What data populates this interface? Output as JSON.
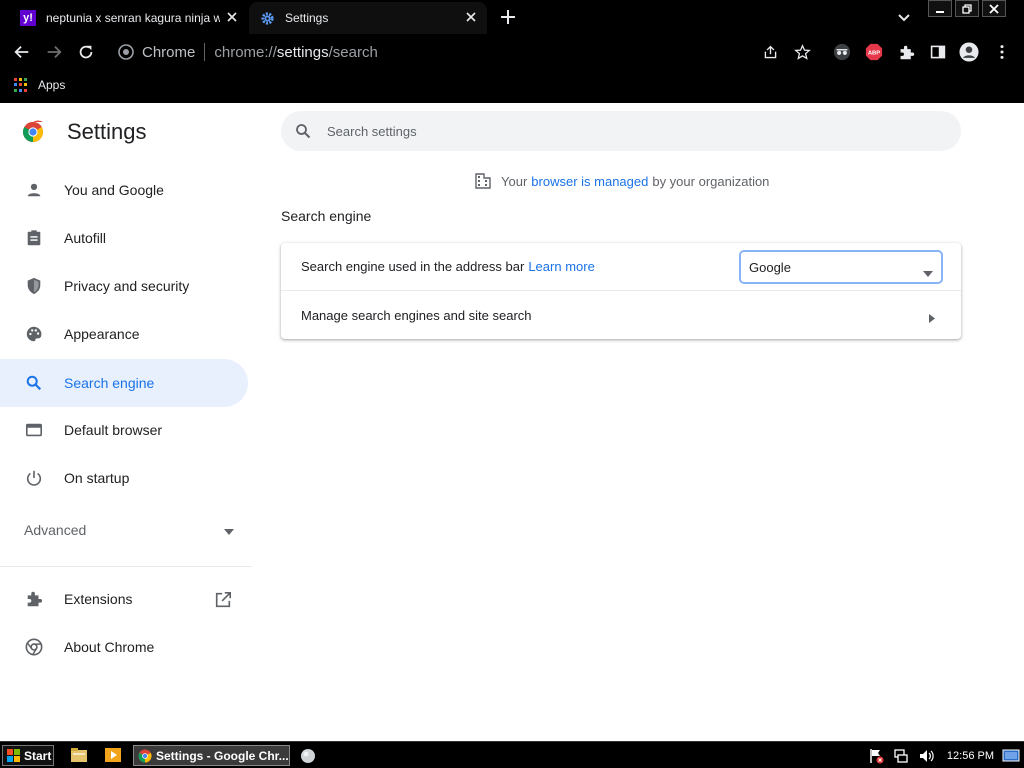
{
  "browser": {
    "tabs": [
      {
        "title": "neptunia x senran kagura ninja wars",
        "favicon_letter": "y!"
      },
      {
        "title": "Settings"
      }
    ],
    "omnibox": {
      "site": "Chrome",
      "url_scheme": "chrome://",
      "url_host": "settings",
      "url_path": "/search"
    },
    "bookmarks": [
      {
        "label": "Apps"
      }
    ]
  },
  "settings": {
    "title": "Settings",
    "search_placeholder": "Search settings",
    "managed_notice": {
      "prefix": "Your",
      "link": "browser is managed",
      "suffix": "by your organization"
    },
    "nav": [
      {
        "label": "You and Google",
        "icon": "person-icon"
      },
      {
        "label": "Autofill",
        "icon": "clipboard-icon"
      },
      {
        "label": "Privacy and security",
        "icon": "shield-icon"
      },
      {
        "label": "Appearance",
        "icon": "palette-icon"
      },
      {
        "label": "Search engine",
        "icon": "search-icon",
        "selected": true
      },
      {
        "label": "Default browser",
        "icon": "browser-window-icon"
      },
      {
        "label": "On startup",
        "icon": "power-icon"
      }
    ],
    "advanced_label": "Advanced",
    "nav_bottom": [
      {
        "label": "Extensions",
        "icon": "puzzle-icon"
      },
      {
        "label": "About Chrome",
        "icon": "chrome-icon"
      }
    ],
    "section_title": "Search engine",
    "rows": {
      "search_engine_label": "Search engine used in the address bar",
      "learn_more": "Learn more",
      "selected_engine": "Google",
      "manage_label": "Manage search engines and site search"
    }
  },
  "taskbar": {
    "start_label": "Start",
    "active_window": "Settings - Google Chr...",
    "clock": "12:56 PM"
  },
  "colors": {
    "accent": "#1a73e8",
    "selected_nav_bg": "#e8f0fe",
    "chrome_bg": "#000000"
  }
}
